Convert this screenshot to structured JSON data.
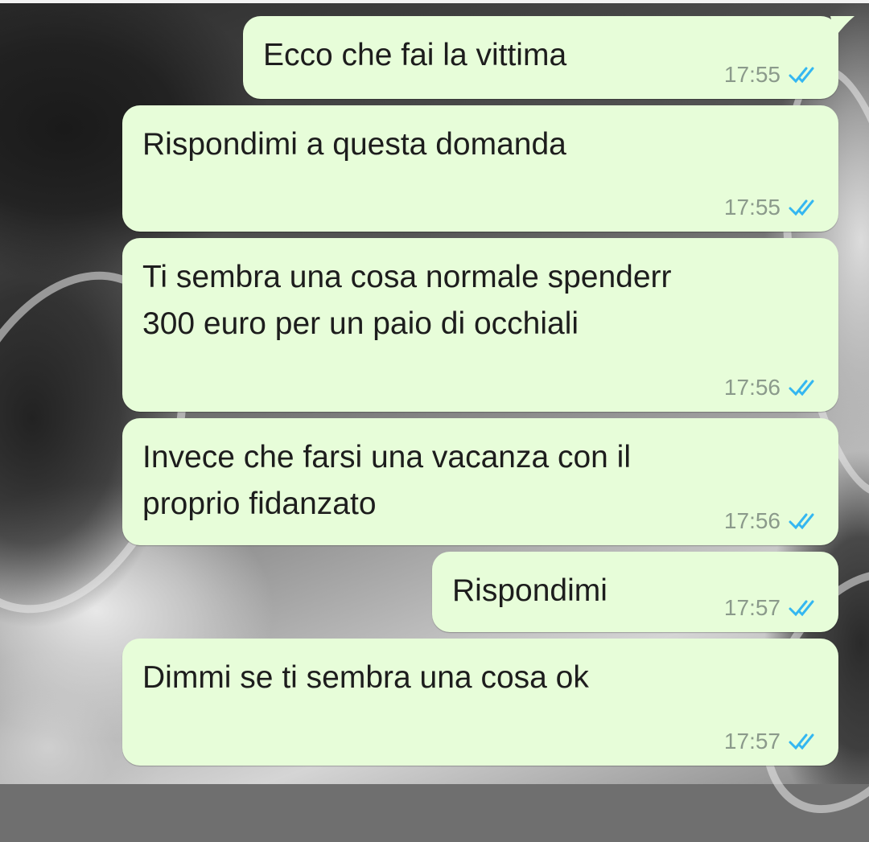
{
  "chat": {
    "messages": [
      {
        "text": "Ecco che fai la vittima",
        "time": "17:55",
        "status_icon": "double-check-read-icon"
      },
      {
        "text": "Rispondimi a questa domanda",
        "time": "17:55",
        "status_icon": "double-check-read-icon"
      },
      {
        "text": "Ti sembra una cosa normale spenderr\n300 euro per un paio di occhiali",
        "time": "17:56",
        "status_icon": "double-check-read-icon"
      },
      {
        "text": "Invece che farsi una vacanza con il\nproprio fidanzato",
        "time": "17:56",
        "status_icon": "double-check-read-icon"
      },
      {
        "text": "Rispondimi",
        "time": "17:57",
        "status_icon": "double-check-read-icon"
      },
      {
        "text": "Dimmi se ti sembra una cosa ok",
        "time": "17:57",
        "status_icon": "double-check-read-icon"
      }
    ]
  },
  "colors": {
    "bubble_background": "#e7fdd9",
    "read_tick": "#34b7f1",
    "timestamp": "#8b9a8b"
  }
}
